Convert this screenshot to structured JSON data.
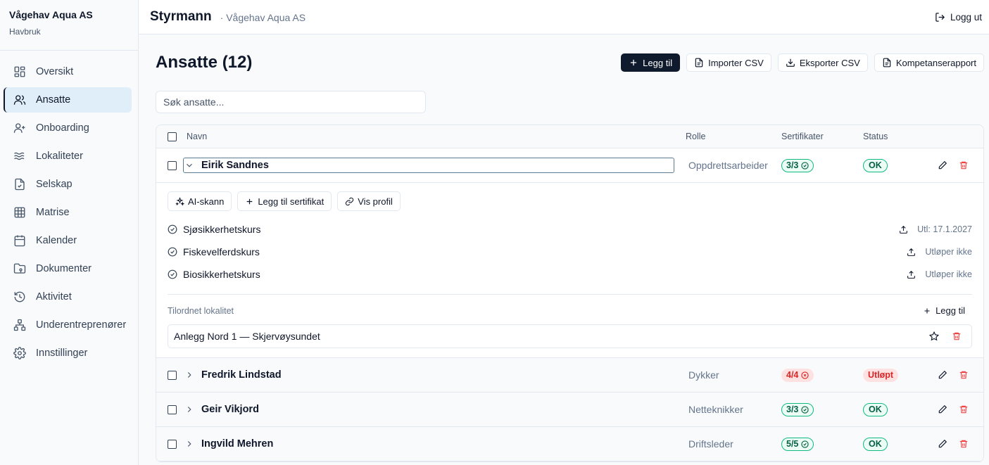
{
  "sidebar": {
    "org_name": "Vågehav Aqua AS",
    "org_type": "Havbruk",
    "items": [
      {
        "label": "Oversikt",
        "icon": "grid-icon"
      },
      {
        "label": "Ansatte",
        "icon": "users-icon",
        "active": true
      },
      {
        "label": "Onboarding",
        "icon": "user-plus-icon"
      },
      {
        "label": "Lokaliteter",
        "icon": "waves-icon"
      },
      {
        "label": "Selskap",
        "icon": "file-icon"
      },
      {
        "label": "Matrise",
        "icon": "table-icon"
      },
      {
        "label": "Kalender",
        "icon": "calendar-icon"
      },
      {
        "label": "Dokumenter",
        "icon": "folder-icon"
      },
      {
        "label": "Aktivitet",
        "icon": "history-icon"
      },
      {
        "label": "Underentreprenører",
        "icon": "network-icon"
      },
      {
        "label": "Innstillinger",
        "icon": "gear-icon"
      }
    ]
  },
  "topbar": {
    "app_name": "Styrmann",
    "org_name": "· Vågehav Aqua AS",
    "logout_label": "Logg ut"
  },
  "page": {
    "title": "Ansatte (12)",
    "actions": {
      "add": "Legg til",
      "import": "Importer CSV",
      "export": "Eksporter CSV",
      "report": "Kompetanserapport"
    },
    "search_placeholder": "Søk ansatte..."
  },
  "table": {
    "headers": {
      "name": "Navn",
      "role": "Rolle",
      "certs": "Sertifikater",
      "status": "Status"
    },
    "expanded": {
      "name": "Eirik Sandnes",
      "role": "Oppdrettsarbeider",
      "certs": "3/3",
      "status": "OK",
      "buttons": {
        "ai_scan": "AI-skann",
        "add_cert": "Legg til sertifikat",
        "view_profile": "Vis profil"
      },
      "certificates": [
        {
          "name": "Sjøsikkerhetskurs",
          "expiry": "Utl: 17.1.2027"
        },
        {
          "name": "Fiskevelferdskurs",
          "expiry": "Utløper ikke"
        },
        {
          "name": "Biosikkerhetskurs",
          "expiry": "Utløper ikke"
        }
      ],
      "location_label": "Tilordnet lokalitet",
      "location_add": "Legg til",
      "location": "Anlegg Nord 1 — Skjervøysundet"
    },
    "rows": [
      {
        "name": "Fredrik Lindstad",
        "role": "Dykker",
        "certs": "4/4",
        "cert_state": "expired",
        "status": "Utløpt"
      },
      {
        "name": "Geir Vikjord",
        "role": "Netteknikker",
        "certs": "3/3",
        "cert_state": "ok",
        "status": "OK"
      },
      {
        "name": "Ingvild Mehren",
        "role": "Driftsleder",
        "certs": "5/5",
        "cert_state": "ok",
        "status": "OK"
      }
    ]
  }
}
